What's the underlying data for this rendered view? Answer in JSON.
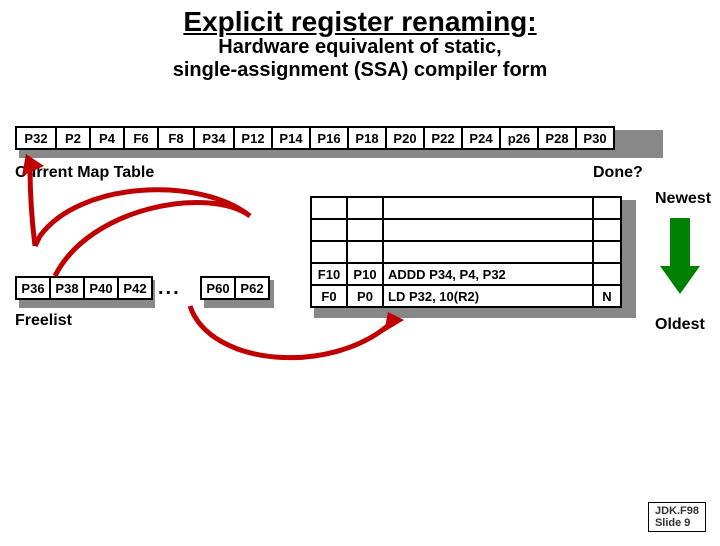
{
  "title": "Explicit register renaming:",
  "subtitle_line1": "Hardware equivalent of static,",
  "subtitle_line2": "single-assignment (SSA) compiler form",
  "map_table": [
    "P32",
    "P2",
    "P4",
    "F6",
    "F8",
    "P34",
    "P12",
    "P14",
    "P16",
    "P18",
    "P20",
    "P22",
    "P24",
    "p26",
    "P28",
    "P30"
  ],
  "map_label": "Current Map Table",
  "done_label": "Done?",
  "newest_label": "Newest",
  "oldest_label": "Oldest",
  "freelist_a": [
    "P36",
    "P38",
    "P40",
    "P42"
  ],
  "freelist_b": [
    "P60",
    "P62"
  ],
  "freelist_dots": "...",
  "freelist_label": "Freelist",
  "rob": {
    "rows": 5,
    "r3": {
      "c0": "F10",
      "c1": "P10",
      "c2": "ADDD P34, P4, P32",
      "c3": ""
    },
    "r4": {
      "c0": "F0",
      "c1": "P0",
      "c2": "LD P32, 10(R2)",
      "c3": "N"
    }
  },
  "footer_line1": "JDK.F98",
  "footer_line2": "Slide 9",
  "chart_data": {
    "type": "table",
    "title": "Explicit register renaming diagram",
    "map_table_values": [
      "P32",
      "P2",
      "P4",
      "F6",
      "F8",
      "P34",
      "P12",
      "P14",
      "P16",
      "P18",
      "P20",
      "P22",
      "P24",
      "p26",
      "P28",
      "P30"
    ],
    "freelist_values": [
      "P36",
      "P38",
      "P40",
      "P42",
      "P60",
      "P62"
    ],
    "reorder_buffer": [
      {
        "dest": "",
        "old": "",
        "op": "",
        "done": ""
      },
      {
        "dest": "",
        "old": "",
        "op": "",
        "done": ""
      },
      {
        "dest": "",
        "old": "",
        "op": "",
        "done": ""
      },
      {
        "dest": "F10",
        "old": "P10",
        "op": "ADDD P34, P4, P32",
        "done": ""
      },
      {
        "dest": "F0",
        "old": "P0",
        "op": "LD P32, 10(R2)",
        "done": "N"
      }
    ]
  }
}
